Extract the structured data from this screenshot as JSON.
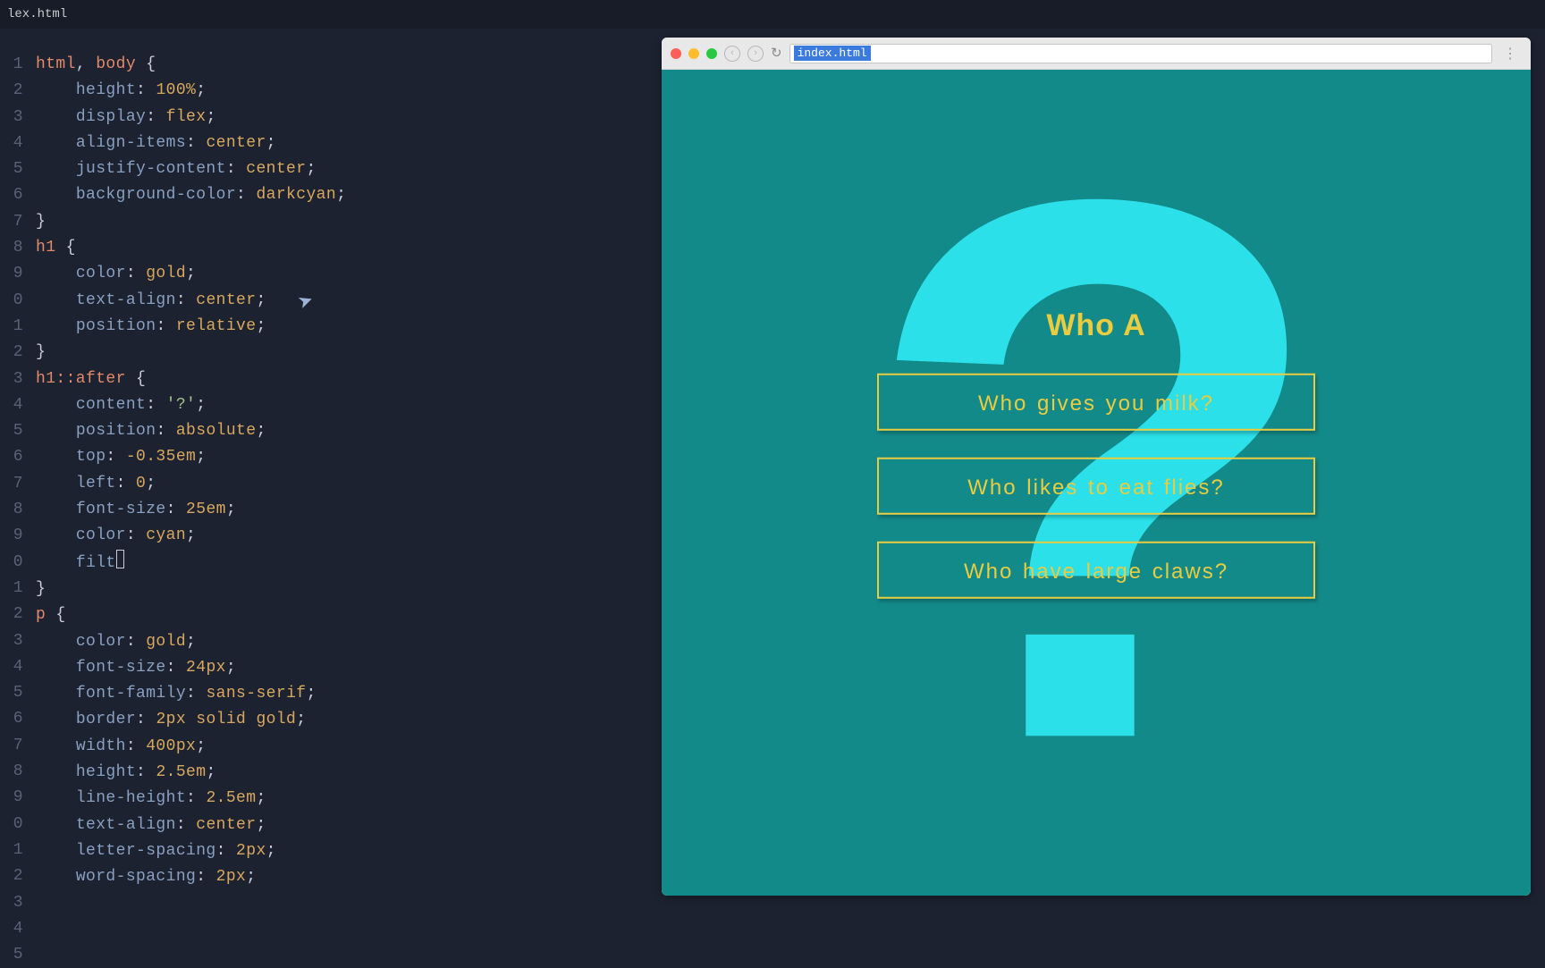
{
  "tab": {
    "filename": "lex.html"
  },
  "browser": {
    "url": "index.html",
    "traffic": {
      "close": "#ff5f57",
      "min": "#ffbd2e",
      "max": "#28c840"
    }
  },
  "preview": {
    "heading": "Who A",
    "questions": [
      "Who gives you milk?",
      "Who likes to eat flies?",
      "Who have large claws?"
    ],
    "bg_mark": "?"
  },
  "code": {
    "lines": [
      {
        "n": "1",
        "t": [
          [
            "sel",
            "html"
          ],
          [
            "punc",
            ", "
          ],
          [
            "sel",
            "body"
          ],
          [
            "punc",
            " {"
          ]
        ]
      },
      {
        "n": "2",
        "t": [
          [
            "punc",
            "    "
          ],
          [
            "prop",
            "height"
          ],
          [
            "punc",
            ": "
          ],
          [
            "val",
            "100%"
          ],
          [
            "punc",
            ";"
          ]
        ]
      },
      {
        "n": "3",
        "t": [
          [
            "punc",
            "    "
          ],
          [
            "prop",
            "display"
          ],
          [
            "punc",
            ": "
          ],
          [
            "val",
            "flex"
          ],
          [
            "punc",
            ";"
          ]
        ]
      },
      {
        "n": "4",
        "t": [
          [
            "punc",
            "    "
          ],
          [
            "prop",
            "align-items"
          ],
          [
            "punc",
            ": "
          ],
          [
            "val",
            "center"
          ],
          [
            "punc",
            ";"
          ]
        ]
      },
      {
        "n": "5",
        "t": [
          [
            "punc",
            "    "
          ],
          [
            "prop",
            "justify-content"
          ],
          [
            "punc",
            ": "
          ],
          [
            "val",
            "center"
          ],
          [
            "punc",
            ";"
          ]
        ]
      },
      {
        "n": "6",
        "t": [
          [
            "punc",
            "    "
          ],
          [
            "prop",
            "background-color"
          ],
          [
            "punc",
            ": "
          ],
          [
            "val",
            "darkcyan"
          ],
          [
            "punc",
            ";"
          ]
        ]
      },
      {
        "n": "7",
        "t": [
          [
            "punc",
            "}"
          ]
        ]
      },
      {
        "n": "8",
        "t": [
          [
            "punc",
            ""
          ]
        ]
      },
      {
        "n": "9",
        "t": [
          [
            "sel",
            "h1"
          ],
          [
            "punc",
            " {"
          ]
        ]
      },
      {
        "n": "0",
        "t": [
          [
            "punc",
            "    "
          ],
          [
            "prop",
            "color"
          ],
          [
            "punc",
            ": "
          ],
          [
            "val",
            "gold"
          ],
          [
            "punc",
            ";"
          ]
        ]
      },
      {
        "n": "1",
        "t": [
          [
            "punc",
            "    "
          ],
          [
            "prop",
            "text-align"
          ],
          [
            "punc",
            ": "
          ],
          [
            "val",
            "center"
          ],
          [
            "punc",
            ";"
          ]
        ]
      },
      {
        "n": "2",
        "t": [
          [
            "punc",
            "    "
          ],
          [
            "prop",
            "position"
          ],
          [
            "punc",
            ": "
          ],
          [
            "val",
            "relative"
          ],
          [
            "punc",
            ";"
          ]
        ]
      },
      {
        "n": "3",
        "t": [
          [
            "punc",
            "}"
          ]
        ]
      },
      {
        "n": "4",
        "t": [
          [
            "punc",
            ""
          ]
        ]
      },
      {
        "n": "5",
        "t": [
          [
            "sel",
            "h1"
          ],
          [
            "sel",
            "::after"
          ],
          [
            "punc",
            " {"
          ]
        ]
      },
      {
        "n": "6",
        "t": [
          [
            "punc",
            "    "
          ],
          [
            "prop",
            "content"
          ],
          [
            "punc",
            ": "
          ],
          [
            "str",
            "'?'"
          ],
          [
            "punc",
            ";"
          ]
        ]
      },
      {
        "n": "7",
        "t": [
          [
            "punc",
            "    "
          ],
          [
            "prop",
            "position"
          ],
          [
            "punc",
            ": "
          ],
          [
            "val",
            "absolute"
          ],
          [
            "punc",
            ";"
          ]
        ]
      },
      {
        "n": "8",
        "t": [
          [
            "punc",
            "    "
          ],
          [
            "prop",
            "top"
          ],
          [
            "punc",
            ": "
          ],
          [
            "val",
            "-0.35em"
          ],
          [
            "punc",
            ";"
          ]
        ]
      },
      {
        "n": "9",
        "t": [
          [
            "punc",
            "    "
          ],
          [
            "prop",
            "left"
          ],
          [
            "punc",
            ": "
          ],
          [
            "val",
            "0"
          ],
          [
            "punc",
            ";"
          ]
        ]
      },
      {
        "n": "0",
        "t": [
          [
            "punc",
            "    "
          ],
          [
            "prop",
            "font-size"
          ],
          [
            "punc",
            ": "
          ],
          [
            "val",
            "25em"
          ],
          [
            "punc",
            ";"
          ]
        ]
      },
      {
        "n": "1",
        "t": [
          [
            "punc",
            "    "
          ],
          [
            "prop",
            "color"
          ],
          [
            "punc",
            ": "
          ],
          [
            "val",
            "cyan"
          ],
          [
            "punc",
            ";"
          ]
        ]
      },
      {
        "n": "2",
        "t": [
          [
            "punc",
            "    "
          ],
          [
            "prop",
            "filt"
          ],
          [
            "cursor",
            ""
          ]
        ]
      },
      {
        "n": "3",
        "t": [
          [
            "punc",
            "}"
          ]
        ]
      },
      {
        "n": "4",
        "t": [
          [
            "punc",
            ""
          ]
        ]
      },
      {
        "n": "5",
        "t": [
          [
            "sel",
            "p"
          ],
          [
            "punc",
            " {"
          ]
        ]
      },
      {
        "n": "6",
        "t": [
          [
            "punc",
            "    "
          ],
          [
            "prop",
            "color"
          ],
          [
            "punc",
            ": "
          ],
          [
            "val",
            "gold"
          ],
          [
            "punc",
            ";"
          ]
        ]
      },
      {
        "n": "7",
        "t": [
          [
            "punc",
            "    "
          ],
          [
            "prop",
            "font-size"
          ],
          [
            "punc",
            ": "
          ],
          [
            "val",
            "24px"
          ],
          [
            "punc",
            ";"
          ]
        ]
      },
      {
        "n": "8",
        "t": [
          [
            "punc",
            "    "
          ],
          [
            "prop",
            "font-family"
          ],
          [
            "punc",
            ": "
          ],
          [
            "val",
            "sans-serif"
          ],
          [
            "punc",
            ";"
          ]
        ]
      },
      {
        "n": "9",
        "t": [
          [
            "punc",
            "    "
          ],
          [
            "prop",
            "border"
          ],
          [
            "punc",
            ": "
          ],
          [
            "val",
            "2px solid gold"
          ],
          [
            "punc",
            ";"
          ]
        ]
      },
      {
        "n": "0",
        "t": [
          [
            "punc",
            "    "
          ],
          [
            "prop",
            "width"
          ],
          [
            "punc",
            ": "
          ],
          [
            "val",
            "400px"
          ],
          [
            "punc",
            ";"
          ]
        ]
      },
      {
        "n": "1",
        "t": [
          [
            "punc",
            "    "
          ],
          [
            "prop",
            "height"
          ],
          [
            "punc",
            ": "
          ],
          [
            "val",
            "2.5em"
          ],
          [
            "punc",
            ";"
          ]
        ]
      },
      {
        "n": "2",
        "t": [
          [
            "punc",
            "    "
          ],
          [
            "prop",
            "line-height"
          ],
          [
            "punc",
            ": "
          ],
          [
            "val",
            "2.5em"
          ],
          [
            "punc",
            ";"
          ]
        ]
      },
      {
        "n": "3",
        "t": [
          [
            "punc",
            "    "
          ],
          [
            "prop",
            "text-align"
          ],
          [
            "punc",
            ": "
          ],
          [
            "val",
            "center"
          ],
          [
            "punc",
            ";"
          ]
        ]
      },
      {
        "n": "4",
        "t": [
          [
            "punc",
            "    "
          ],
          [
            "prop",
            "letter-spacing"
          ],
          [
            "punc",
            ": "
          ],
          [
            "val",
            "2px"
          ],
          [
            "punc",
            ";"
          ]
        ]
      },
      {
        "n": "5",
        "t": [
          [
            "punc",
            "    "
          ],
          [
            "prop",
            "word-spacing"
          ],
          [
            "punc",
            ": "
          ],
          [
            "val",
            "2px"
          ],
          [
            "punc",
            ";"
          ]
        ]
      }
    ]
  }
}
